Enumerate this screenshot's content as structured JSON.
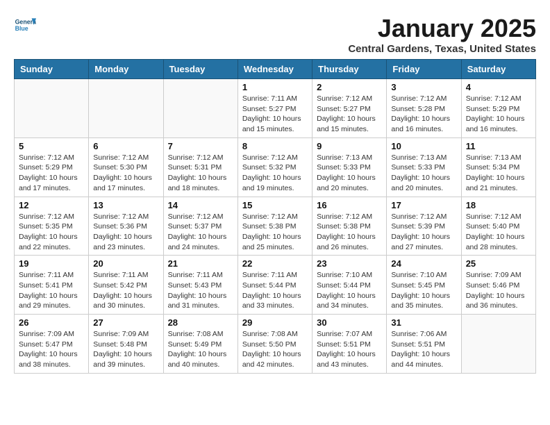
{
  "logo": {
    "general": "General",
    "blue": "Blue"
  },
  "title": "January 2025",
  "subtitle": "Central Gardens, Texas, United States",
  "days_of_week": [
    "Sunday",
    "Monday",
    "Tuesday",
    "Wednesday",
    "Thursday",
    "Friday",
    "Saturday"
  ],
  "weeks": [
    [
      {
        "day": "",
        "info": ""
      },
      {
        "day": "",
        "info": ""
      },
      {
        "day": "",
        "info": ""
      },
      {
        "day": "1",
        "info": "Sunrise: 7:11 AM\nSunset: 5:27 PM\nDaylight: 10 hours\nand 15 minutes."
      },
      {
        "day": "2",
        "info": "Sunrise: 7:12 AM\nSunset: 5:27 PM\nDaylight: 10 hours\nand 15 minutes."
      },
      {
        "day": "3",
        "info": "Sunrise: 7:12 AM\nSunset: 5:28 PM\nDaylight: 10 hours\nand 16 minutes."
      },
      {
        "day": "4",
        "info": "Sunrise: 7:12 AM\nSunset: 5:29 PM\nDaylight: 10 hours\nand 16 minutes."
      }
    ],
    [
      {
        "day": "5",
        "info": "Sunrise: 7:12 AM\nSunset: 5:29 PM\nDaylight: 10 hours\nand 17 minutes."
      },
      {
        "day": "6",
        "info": "Sunrise: 7:12 AM\nSunset: 5:30 PM\nDaylight: 10 hours\nand 17 minutes."
      },
      {
        "day": "7",
        "info": "Sunrise: 7:12 AM\nSunset: 5:31 PM\nDaylight: 10 hours\nand 18 minutes."
      },
      {
        "day": "8",
        "info": "Sunrise: 7:12 AM\nSunset: 5:32 PM\nDaylight: 10 hours\nand 19 minutes."
      },
      {
        "day": "9",
        "info": "Sunrise: 7:13 AM\nSunset: 5:33 PM\nDaylight: 10 hours\nand 20 minutes."
      },
      {
        "day": "10",
        "info": "Sunrise: 7:13 AM\nSunset: 5:33 PM\nDaylight: 10 hours\nand 20 minutes."
      },
      {
        "day": "11",
        "info": "Sunrise: 7:13 AM\nSunset: 5:34 PM\nDaylight: 10 hours\nand 21 minutes."
      }
    ],
    [
      {
        "day": "12",
        "info": "Sunrise: 7:12 AM\nSunset: 5:35 PM\nDaylight: 10 hours\nand 22 minutes."
      },
      {
        "day": "13",
        "info": "Sunrise: 7:12 AM\nSunset: 5:36 PM\nDaylight: 10 hours\nand 23 minutes."
      },
      {
        "day": "14",
        "info": "Sunrise: 7:12 AM\nSunset: 5:37 PM\nDaylight: 10 hours\nand 24 minutes."
      },
      {
        "day": "15",
        "info": "Sunrise: 7:12 AM\nSunset: 5:38 PM\nDaylight: 10 hours\nand 25 minutes."
      },
      {
        "day": "16",
        "info": "Sunrise: 7:12 AM\nSunset: 5:38 PM\nDaylight: 10 hours\nand 26 minutes."
      },
      {
        "day": "17",
        "info": "Sunrise: 7:12 AM\nSunset: 5:39 PM\nDaylight: 10 hours\nand 27 minutes."
      },
      {
        "day": "18",
        "info": "Sunrise: 7:12 AM\nSunset: 5:40 PM\nDaylight: 10 hours\nand 28 minutes."
      }
    ],
    [
      {
        "day": "19",
        "info": "Sunrise: 7:11 AM\nSunset: 5:41 PM\nDaylight: 10 hours\nand 29 minutes."
      },
      {
        "day": "20",
        "info": "Sunrise: 7:11 AM\nSunset: 5:42 PM\nDaylight: 10 hours\nand 30 minutes."
      },
      {
        "day": "21",
        "info": "Sunrise: 7:11 AM\nSunset: 5:43 PM\nDaylight: 10 hours\nand 31 minutes."
      },
      {
        "day": "22",
        "info": "Sunrise: 7:11 AM\nSunset: 5:44 PM\nDaylight: 10 hours\nand 33 minutes."
      },
      {
        "day": "23",
        "info": "Sunrise: 7:10 AM\nSunset: 5:44 PM\nDaylight: 10 hours\nand 34 minutes."
      },
      {
        "day": "24",
        "info": "Sunrise: 7:10 AM\nSunset: 5:45 PM\nDaylight: 10 hours\nand 35 minutes."
      },
      {
        "day": "25",
        "info": "Sunrise: 7:09 AM\nSunset: 5:46 PM\nDaylight: 10 hours\nand 36 minutes."
      }
    ],
    [
      {
        "day": "26",
        "info": "Sunrise: 7:09 AM\nSunset: 5:47 PM\nDaylight: 10 hours\nand 38 minutes."
      },
      {
        "day": "27",
        "info": "Sunrise: 7:09 AM\nSunset: 5:48 PM\nDaylight: 10 hours\nand 39 minutes."
      },
      {
        "day": "28",
        "info": "Sunrise: 7:08 AM\nSunset: 5:49 PM\nDaylight: 10 hours\nand 40 minutes."
      },
      {
        "day": "29",
        "info": "Sunrise: 7:08 AM\nSunset: 5:50 PM\nDaylight: 10 hours\nand 42 minutes."
      },
      {
        "day": "30",
        "info": "Sunrise: 7:07 AM\nSunset: 5:51 PM\nDaylight: 10 hours\nand 43 minutes."
      },
      {
        "day": "31",
        "info": "Sunrise: 7:06 AM\nSunset: 5:51 PM\nDaylight: 10 hours\nand 44 minutes."
      },
      {
        "day": "",
        "info": ""
      }
    ]
  ]
}
